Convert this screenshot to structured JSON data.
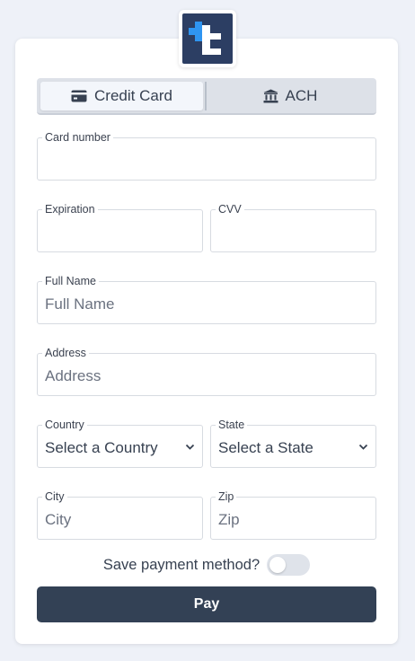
{
  "brand": {
    "logo_letter": "t",
    "logo_bg": "#2c3e63",
    "logo_accent": "#2f95f1"
  },
  "tabs": [
    {
      "label": "Credit Card",
      "icon": "credit-card-icon",
      "active": true
    },
    {
      "label": "ACH",
      "icon": "bank-icon",
      "active": false
    }
  ],
  "fields": {
    "card_number": {
      "label": "Card number",
      "placeholder": ""
    },
    "expiration": {
      "label": "Expiration",
      "placeholder": ""
    },
    "cvv": {
      "label": "CVV",
      "placeholder": ""
    },
    "full_name": {
      "label": "Full Name",
      "placeholder": "Full Name"
    },
    "address": {
      "label": "Address",
      "placeholder": "Address"
    },
    "country": {
      "label": "Country",
      "value": "Select a Country"
    },
    "state": {
      "label": "State",
      "value": "Select a State"
    },
    "city": {
      "label": "City",
      "placeholder": "City"
    },
    "zip": {
      "label": "Zip",
      "placeholder": "Zip"
    }
  },
  "save_method": {
    "label": "Save payment method?",
    "enabled": false
  },
  "pay_button": {
    "label": "Pay",
    "color": "#334155"
  }
}
